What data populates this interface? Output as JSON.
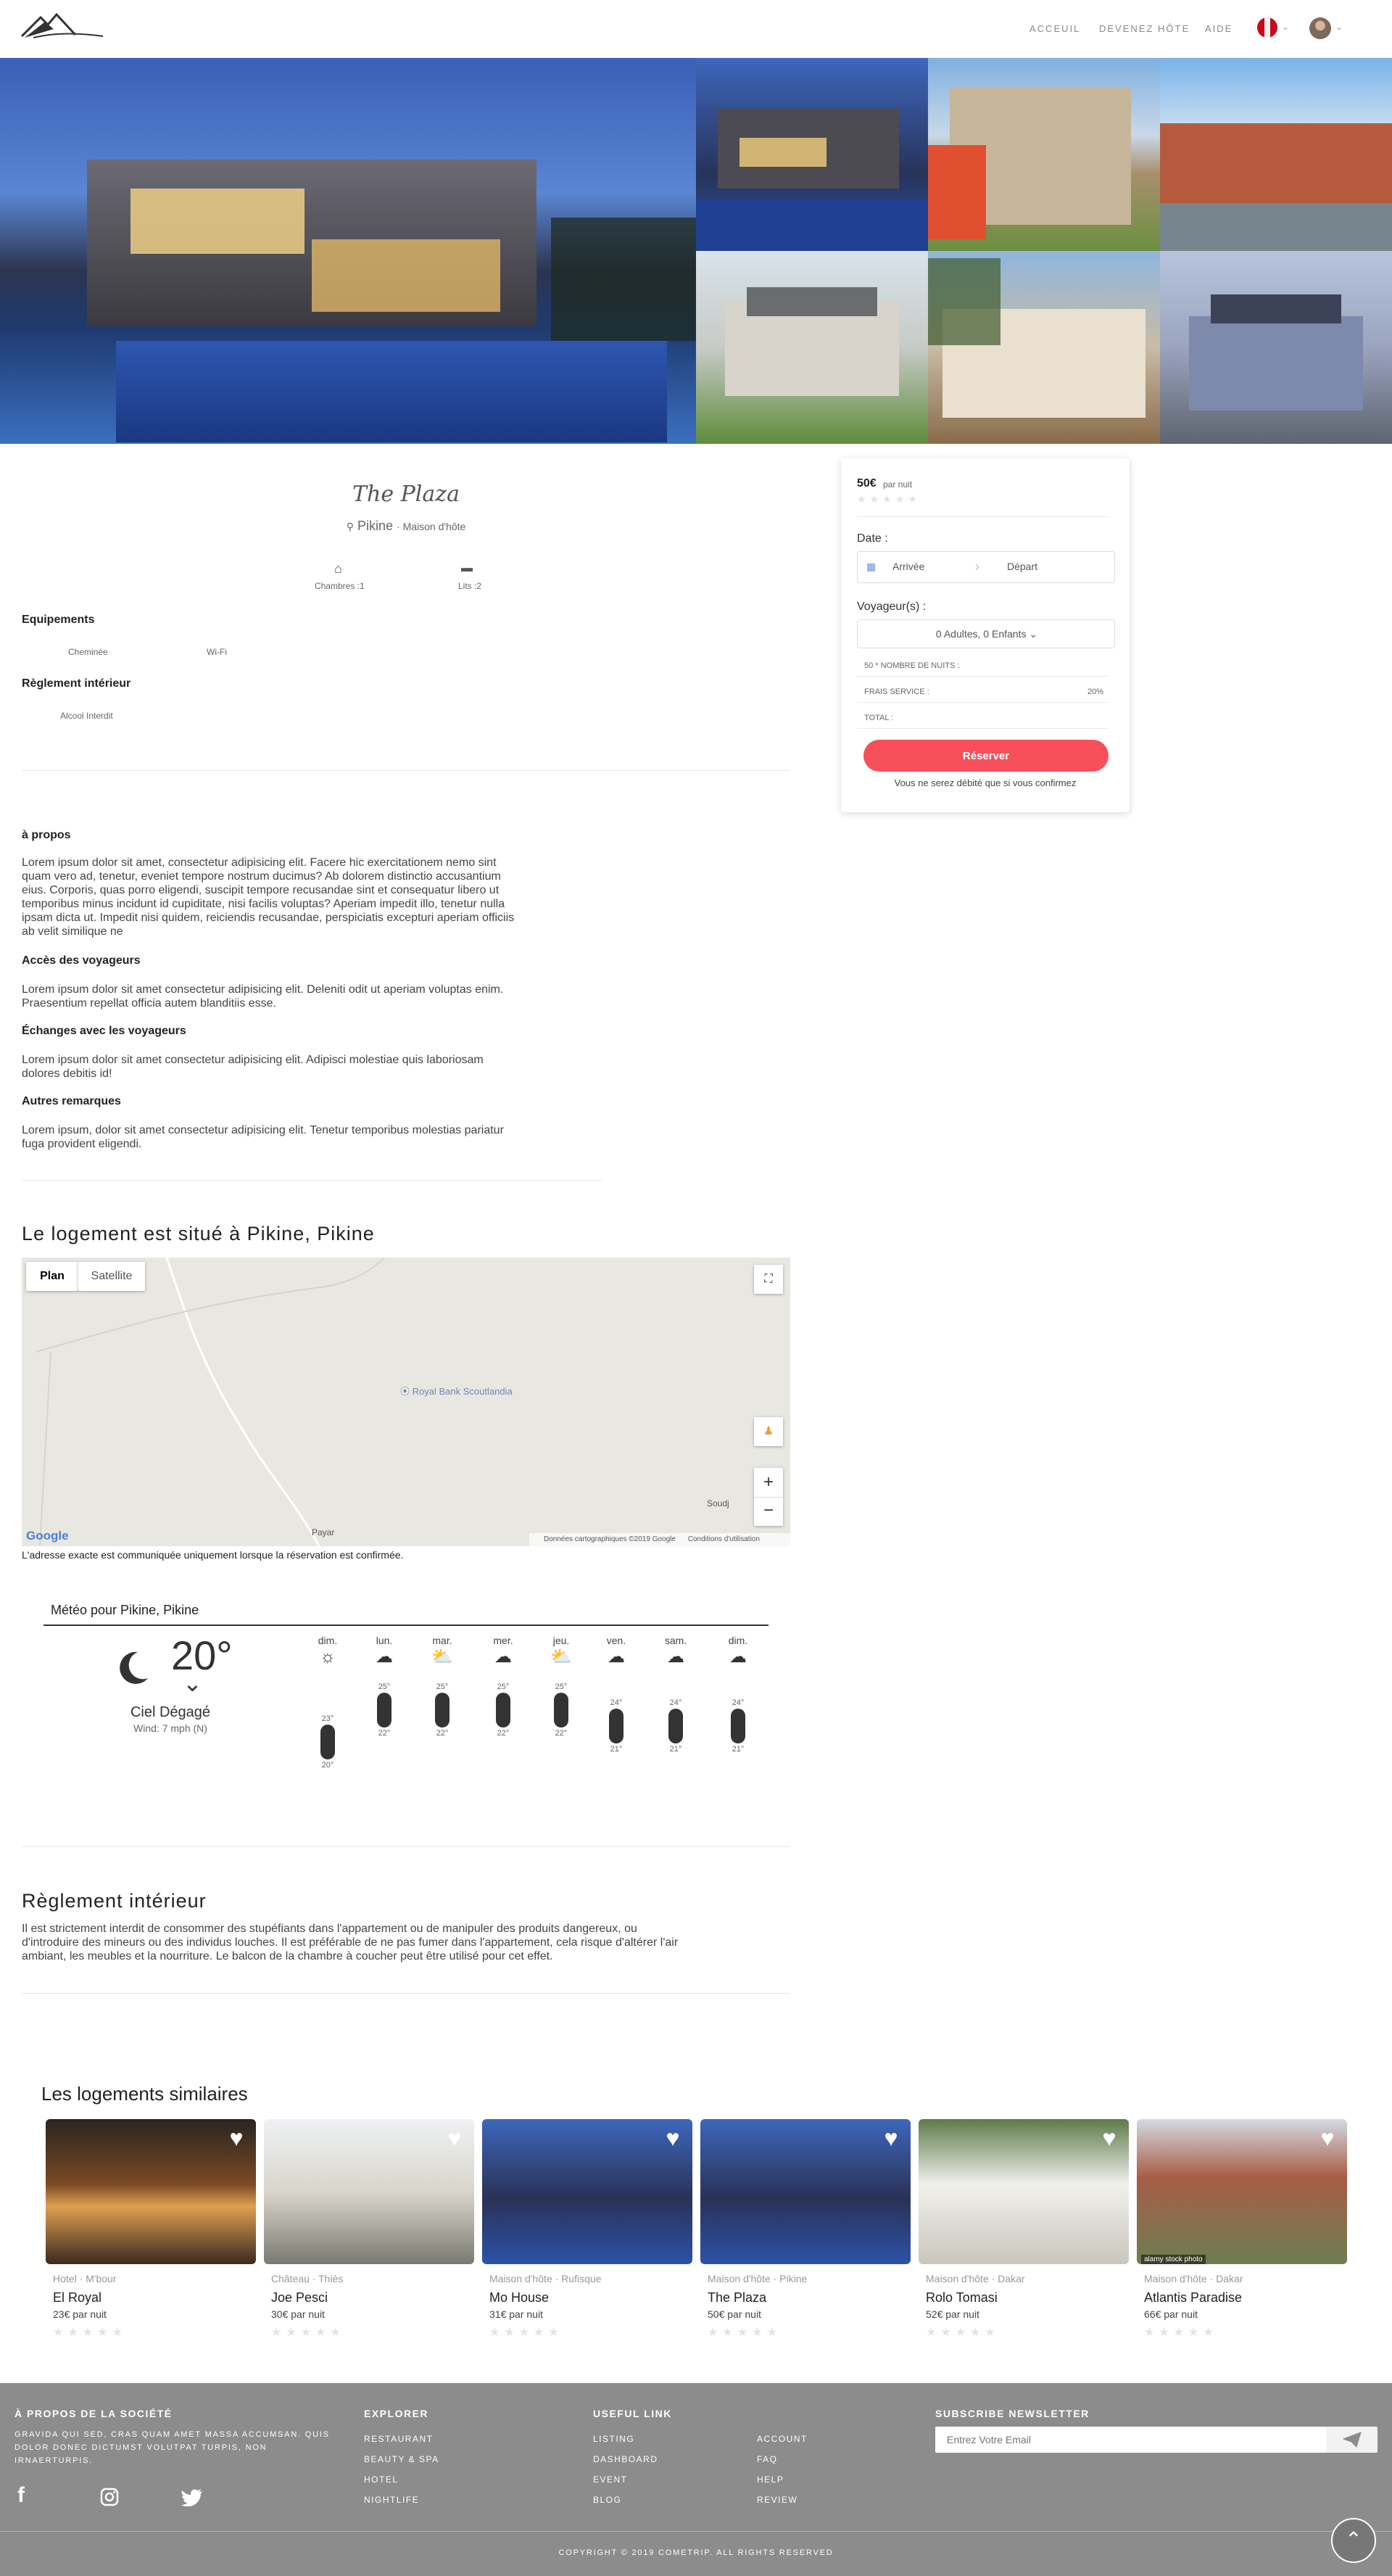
{
  "header": {
    "nav": [
      "ACCEUIL",
      "DEVENEZ HÔTE",
      "AIDE"
    ]
  },
  "listing": {
    "title": "The Plaza",
    "city": "Pikine",
    "type": "· Maison d'hôte",
    "rooms_label": "Chambres :1",
    "beds_label": "Lits :2",
    "equipment_title": "Equipements",
    "equipment": [
      "Cheminée",
      "Wi-Fi"
    ],
    "rules_title": "Règlement intérieur",
    "rules": [
      "Alcool Interdit"
    ]
  },
  "booking": {
    "price": "50€",
    "per_night": "par nuit",
    "stars": "★★★★★",
    "date_label": "Date :",
    "arrival": "Arrivée",
    "departure": "Départ",
    "guests_label": "Voyageur(s) :",
    "guests_value": "0 Adultes, 0 Enfants",
    "nights_line": "50 * NOMBRE DE NUITS :",
    "fee_label": "FRAIS SERVICE :",
    "fee_value": "20%",
    "total_label": "TOTAL :",
    "reserve": "Réserver",
    "note": "Vous ne serez débité que si vous confirmez"
  },
  "about": {
    "title": "à propos",
    "text": [
      "Lorem ipsum dolor sit amet, consectetur adipisicing elit. Facere hic exercitationem nemo sint",
      "quam vero ad, tenetur, eveniet tempore nostrum ducimus? Ab dolorem distinctio accusantium",
      "eius. Corporis, quas porro eligendi, suscipit tempore recusandae sint et consequatur libero ut",
      "temporibus minus incidunt id cupiditate, nisi facilis voluptas? Aperiam impedit illo, tenetur nulla",
      "ipsam dicta ut. Impedit nisi quidem, reiciendis recusandae, perspiciatis excepturi aperiam officiis",
      "ab velit similique ne"
    ],
    "access_title": "Accès des voyageurs",
    "access_text": [
      "Lorem ipsum dolor sit amet consectetur adipisicing elit. Deleniti odit ut aperiam voluptas enim.",
      "Praesentium repellat officia autem blanditiis esse."
    ],
    "exchange_title": "Échanges avec les voyageurs",
    "exchange_text": [
      "Lorem ipsum dolor sit amet consectetur adipisicing elit. Adipisci molestiae quis laboriosam",
      "dolores debitis id!"
    ],
    "other_title": "Autres remarques",
    "other_text": [
      "Lorem ipsum, dolor sit amet consectetur adipisicing elit. Tenetur temporibus molestias pariatur",
      "fuga provident eligendi."
    ]
  },
  "location": {
    "title": "Le logement est situé à Pikine, Pikine",
    "map_plan": "Plan",
    "map_satellite": "Satellite",
    "poi": "Royal Bank Scoutlandia",
    "place_payar": "Payar",
    "place_soudj": "Soudj",
    "google": "Google",
    "attribution": "Données cartographiques ©2019 Google",
    "terms": "Conditions d'utilisation",
    "note": "L'adresse exacte est communiquée uniquement lorsque la réservation est confirmée."
  },
  "weather": {
    "title": "Météo pour Pikine, Pikine",
    "temp": "20°",
    "condition": "Ciel Dégagé",
    "wind": "Wind: 7 mph (N)",
    "days": [
      {
        "day": "dim.",
        "icon": "sun-icon",
        "high": "23°",
        "low": "20°",
        "high_n": 23,
        "low_n": 20
      },
      {
        "day": "lun.",
        "icon": "moon-cloud-icon",
        "high": "25°",
        "low": "22°",
        "high_n": 25,
        "low_n": 22
      },
      {
        "day": "mar.",
        "icon": "sun-cloud-icon",
        "high": "25°",
        "low": "22°",
        "high_n": 25,
        "low_n": 22
      },
      {
        "day": "mer.",
        "icon": "moon-cloud-icon",
        "high": "25°",
        "low": "22°",
        "high_n": 25,
        "low_n": 22
      },
      {
        "day": "jeu.",
        "icon": "sun-cloud-icon",
        "high": "25°",
        "low": "22°",
        "high_n": 25,
        "low_n": 22
      },
      {
        "day": "ven.",
        "icon": "moon-cloud-icon",
        "high": "24°",
        "low": "21°",
        "high_n": 24,
        "low_n": 21
      },
      {
        "day": "sam.",
        "icon": "moon-cloud-icon",
        "high": "24°",
        "low": "21°",
        "high_n": 24,
        "low_n": 21
      },
      {
        "day": "dim.",
        "icon": "moon-cloud-icon",
        "high": "24°",
        "low": "21°",
        "high_n": 24,
        "low_n": 21
      }
    ]
  },
  "rules_section": {
    "title": "Règlement intérieur",
    "text": [
      "Il est strictement interdit de consommer des stupéfiants dans l'appartement ou de manipuler des produits dangereux, ou",
      "d'introduire des mineurs ou des individus louches. Il est préférable de ne pas fumer dans l'appartement, cela risque d'altérer l'air",
      "ambiant, les meubles et la nourriture. Le balcon de la chambre à coucher peut être utilisé pour cet effet."
    ]
  },
  "similar": {
    "title": "Les logements similaires",
    "items": [
      {
        "sub": "Hotel · M'bour",
        "name": "El Royal",
        "price": "23€ par nuit"
      },
      {
        "sub": "Château · Thiès",
        "name": "Joe Pesci",
        "price": "30€ par nuit"
      },
      {
        "sub": "Maison d'hôte · Rufisque",
        "name": "Mo House",
        "price": "31€ par nuit"
      },
      {
        "sub": "Maison d'hôte · Pikine",
        "name": "The Plaza",
        "price": "50€ par nuit"
      },
      {
        "sub": "Maison d'hôte · Dakar",
        "name": "Rolo Tomasi",
        "price": "52€ par nuit"
      },
      {
        "sub": "Maison d'hôte · Dakar",
        "name": "Atlantis Paradise",
        "price": "66€ par nuit"
      }
    ],
    "stars": "★★★★★",
    "watermark": "alamy stock photo"
  },
  "footer": {
    "about_title": "À PROPOS DE LA SOCIÉTÉ",
    "about_text": [
      "GRAVIDA QUI SED, CRAS QUAM AMET MASSA ACCUMSAN. QUIS",
      "DOLOR DONEC DICTUMST VOLUTPAT TURPIS, NON",
      "IRNAERTURPIS."
    ],
    "explorer_title": "EXPLORER",
    "explorer": [
      "RESTAURANT",
      "BEAUTY & SPA",
      "HOTEL",
      "NIGHTLIFE"
    ],
    "useful_title": "USEFUL LINK",
    "useful_a": [
      "LISTING",
      "DASHBOARD",
      "EVENT",
      "BLOG"
    ],
    "useful_b": [
      "ACCOUNT",
      "FAQ",
      "HELP",
      "REVIEW"
    ],
    "newsletter_title": "SUBSCRIBE NEWSLETTER",
    "email_placeholder": "Entrez Votre Email",
    "copyright": "COPYRIGHT © 2019 COMETRIP. ALL RIGHTS RESERVED"
  }
}
